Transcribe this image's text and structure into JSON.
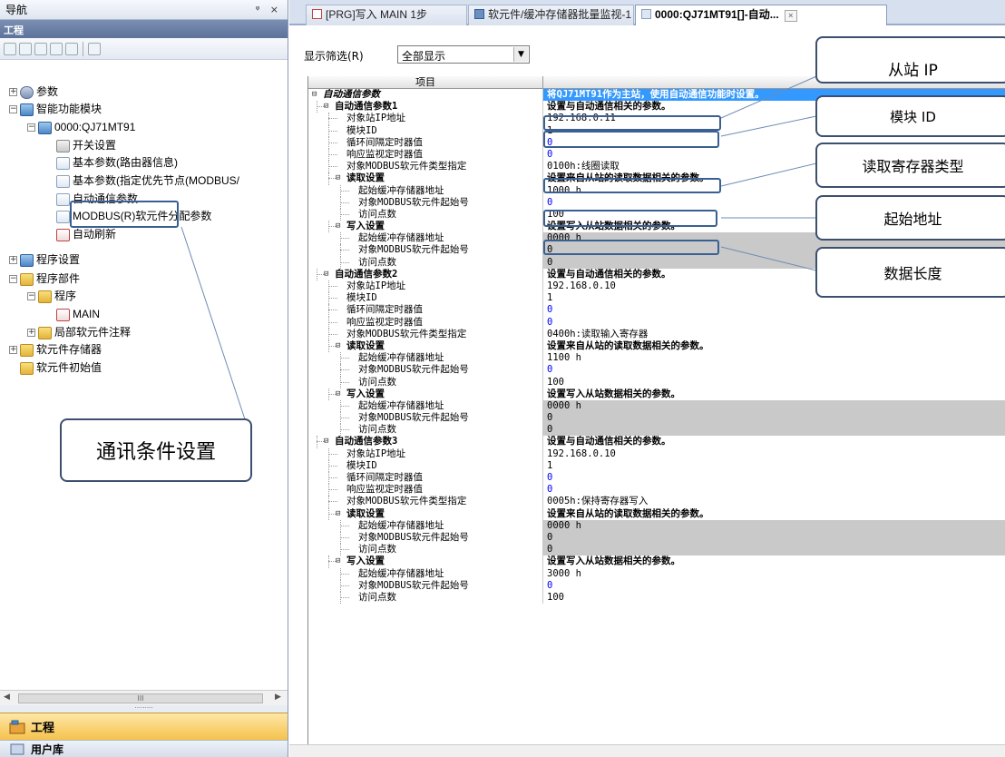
{
  "nav": {
    "title": "导航",
    "pin": "ᵠ ×",
    "section": "工程",
    "tree": [
      {
        "label": "参数",
        "indent": 0,
        "exp": "+",
        "icon": "gear"
      },
      {
        "label": "智能功能模块",
        "indent": 0,
        "exp": "−",
        "icon": "module"
      },
      {
        "label": "0000:QJ71MT91",
        "indent": 1,
        "exp": "−",
        "icon": "module"
      },
      {
        "label": "开关设置",
        "indent": 2,
        "exp": "",
        "icon": "switch"
      },
      {
        "label": "基本参数(路由器信息)",
        "indent": 2,
        "exp": "",
        "icon": "doc"
      },
      {
        "label": "基本参数(指定优先节点(MODBUS/",
        "indent": 2,
        "exp": "",
        "icon": "doc"
      },
      {
        "label": "自动通信参数",
        "indent": 2,
        "exp": "",
        "icon": "doc"
      },
      {
        "label": "MODBUS(R)软元件分配参数",
        "indent": 2,
        "exp": "",
        "icon": "doc"
      },
      {
        "label": "自动刷新",
        "indent": 2,
        "exp": "",
        "icon": "red"
      },
      {
        "label": "程序设置",
        "indent": 0,
        "exp": "+",
        "icon": "module"
      },
      {
        "label": "程序部件",
        "indent": 0,
        "exp": "−",
        "icon": "folder"
      },
      {
        "label": "程序",
        "indent": 1,
        "exp": "−",
        "icon": "folder"
      },
      {
        "label": "MAIN",
        "indent": 2,
        "exp": "",
        "icon": "red"
      },
      {
        "label": "局部软元件注释",
        "indent": 1,
        "exp": "+",
        "icon": "folder"
      },
      {
        "label": "软元件存储器",
        "indent": 0,
        "exp": "+",
        "icon": "folder"
      },
      {
        "label": "软元件初始值",
        "indent": 0,
        "exp": "",
        "icon": "folder"
      }
    ],
    "scroll_thumb": "III",
    "tab_project": "工程",
    "tab_library": "用户库"
  },
  "tabs": [
    {
      "label": "[PRG]写入 MAIN 1步",
      "active": false
    },
    {
      "label": "软元件/缓冲存储器批量监视-1",
      "active": false
    },
    {
      "label": "0000:QJ71MT91[]-自动...",
      "active": true
    }
  ],
  "tab_close": "×",
  "filter": {
    "label": "显示筛选(R)",
    "value": "全部显示"
  },
  "grid": {
    "header_item": "项目",
    "rows": [
      {
        "label": "自动通信参数",
        "value": "将QJ71MT91作为主站，使用自动通信功能时设置。",
        "level": 0,
        "mk": "−",
        "style": "italic sel"
      },
      {
        "label": "自动通信参数1",
        "value": "设置与自动通信相关的参数。",
        "level": 1,
        "mk": "−",
        "style": "bold"
      },
      {
        "label": "对象站IP地址",
        "value": "192.168.0.11",
        "level": 2,
        "mk": "",
        "style": ""
      },
      {
        "label": "模块ID",
        "value": "1",
        "level": 2,
        "mk": "",
        "style": ""
      },
      {
        "label": "循环间隔定时器值",
        "value": "0",
        "level": 2,
        "mk": "",
        "style": "blue"
      },
      {
        "label": "响应监视定时器值",
        "value": "0",
        "level": 2,
        "mk": "",
        "style": "blue"
      },
      {
        "label": "对象MODBUS软元件类型指定",
        "value": "0100h:线圈读取",
        "level": 2,
        "mk": "",
        "style": ""
      },
      {
        "label": "读取设置",
        "value": "设置来自从站的读取数据相关的参数。",
        "level": 2,
        "mk": "−",
        "style": "bold"
      },
      {
        "label": "起始缓冲存储器地址",
        "value": "1000 h",
        "level": 3,
        "mk": "",
        "style": ""
      },
      {
        "label": "对象MODBUS软元件起始号",
        "value": "0",
        "level": 3,
        "mk": "",
        "style": "blue"
      },
      {
        "label": "访问点数",
        "value": "100",
        "level": 3,
        "mk": "",
        "style": ""
      },
      {
        "label": "写入设置",
        "value": "设置写入从站数据相关的参数。",
        "level": 2,
        "mk": "−",
        "style": "bold"
      },
      {
        "label": "起始缓冲存储器地址",
        "value": "0000 h",
        "level": 3,
        "mk": "",
        "style": "gray"
      },
      {
        "label": "对象MODBUS软元件起始号",
        "value": "0",
        "level": 3,
        "mk": "",
        "style": "gray"
      },
      {
        "label": "访问点数",
        "value": "0",
        "level": 3,
        "mk": "",
        "style": "gray"
      },
      {
        "label": "自动通信参数2",
        "value": "设置与自动通信相关的参数。",
        "level": 1,
        "mk": "−",
        "style": "bold"
      },
      {
        "label": "对象站IP地址",
        "value": "192.168.0.10",
        "level": 2,
        "mk": "",
        "style": ""
      },
      {
        "label": "模块ID",
        "value": "1",
        "level": 2,
        "mk": "",
        "style": ""
      },
      {
        "label": "循环间隔定时器值",
        "value": "0",
        "level": 2,
        "mk": "",
        "style": "blue"
      },
      {
        "label": "响应监视定时器值",
        "value": "0",
        "level": 2,
        "mk": "",
        "style": "blue"
      },
      {
        "label": "对象MODBUS软元件类型指定",
        "value": "0400h:读取输入寄存器",
        "level": 2,
        "mk": "",
        "style": ""
      },
      {
        "label": "读取设置",
        "value": "设置来自从站的读取数据相关的参数。",
        "level": 2,
        "mk": "−",
        "style": "bold"
      },
      {
        "label": "起始缓冲存储器地址",
        "value": "1100 h",
        "level": 3,
        "mk": "",
        "style": ""
      },
      {
        "label": "对象MODBUS软元件起始号",
        "value": "0",
        "level": 3,
        "mk": "",
        "style": "blue"
      },
      {
        "label": "访问点数",
        "value": "100",
        "level": 3,
        "mk": "",
        "style": ""
      },
      {
        "label": "写入设置",
        "value": "设置写入从站数据相关的参数。",
        "level": 2,
        "mk": "−",
        "style": "bold"
      },
      {
        "label": "起始缓冲存储器地址",
        "value": "0000 h",
        "level": 3,
        "mk": "",
        "style": "gray"
      },
      {
        "label": "对象MODBUS软元件起始号",
        "value": "0",
        "level": 3,
        "mk": "",
        "style": "gray"
      },
      {
        "label": "访问点数",
        "value": "0",
        "level": 3,
        "mk": "",
        "style": "gray"
      },
      {
        "label": "自动通信参数3",
        "value": "设置与自动通信相关的参数。",
        "level": 1,
        "mk": "−",
        "style": "bold"
      },
      {
        "label": "对象站IP地址",
        "value": "192.168.0.10",
        "level": 2,
        "mk": "",
        "style": ""
      },
      {
        "label": "模块ID",
        "value": "1",
        "level": 2,
        "mk": "",
        "style": ""
      },
      {
        "label": "循环间隔定时器值",
        "value": "0",
        "level": 2,
        "mk": "",
        "style": "blue"
      },
      {
        "label": "响应监视定时器值",
        "value": "0",
        "level": 2,
        "mk": "",
        "style": "blue"
      },
      {
        "label": "对象MODBUS软元件类型指定",
        "value": "0005h:保持寄存器写入",
        "level": 2,
        "mk": "",
        "style": ""
      },
      {
        "label": "读取设置",
        "value": "设置来自从站的读取数据相关的参数。",
        "level": 2,
        "mk": "−",
        "style": "bold"
      },
      {
        "label": "起始缓冲存储器地址",
        "value": "0000 h",
        "level": 3,
        "mk": "",
        "style": "gray"
      },
      {
        "label": "对象MODBUS软元件起始号",
        "value": "0",
        "level": 3,
        "mk": "",
        "style": "gray"
      },
      {
        "label": "访问点数",
        "value": "0",
        "level": 3,
        "mk": "",
        "style": "gray"
      },
      {
        "label": "写入设置",
        "value": "设置写入从站数据相关的参数。",
        "level": 2,
        "mk": "−",
        "style": "bold"
      },
      {
        "label": "起始缓冲存储器地址",
        "value": "3000 h",
        "level": 3,
        "mk": "",
        "style": ""
      },
      {
        "label": "对象MODBUS软元件起始号",
        "value": "0",
        "level": 3,
        "mk": "",
        "style": "blue"
      },
      {
        "label": "访问点数",
        "value": "100",
        "level": 3,
        "mk": "",
        "style": ""
      }
    ]
  },
  "callouts": {
    "slave_ip": "从站 IP",
    "module_id": "模块 ID",
    "read_register_type": "读取寄存器类型",
    "start_address": "起始地址",
    "data_length": "数据长度",
    "comm_settings": "通讯条件设置"
  }
}
